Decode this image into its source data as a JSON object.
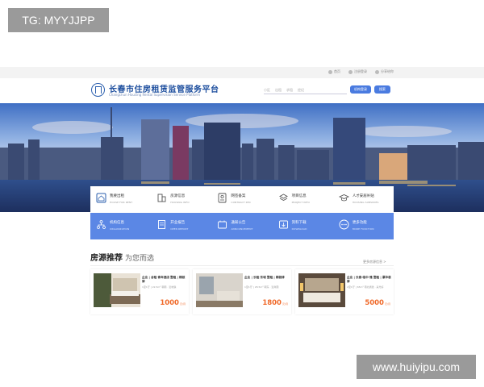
{
  "watermarks": {
    "top_left": "TG: MYYJJPP",
    "bottom_right": "www.huiyipu.com"
  },
  "topbar": {
    "links": [
      "首页",
      "注册登录",
      "分享给你"
    ]
  },
  "header": {
    "title": "长春市住房租赁监管服务平台",
    "subtitle": "Changchun Housing Rental Supervision Service Platform",
    "search_tabs": [
      "小区",
      "出租",
      "求租",
      "经纪"
    ],
    "btn_primary": "机构登录",
    "btn_secondary": "搜索"
  },
  "quick_top": [
    {
      "label": "我要出租",
      "en": "HOUSE FOR RENT",
      "icon": "house-icon"
    },
    {
      "label": "房源信息",
      "en": "HOUSING INFO",
      "icon": "building-icon"
    },
    {
      "label": "网签备案",
      "en": "CONTRACT REC",
      "icon": "id-card-icon"
    },
    {
      "label": "项目信息",
      "en": "PROJECT INFO",
      "icon": "layers-icon"
    },
    {
      "label": "人才安居补贴",
      "en": "HOUSING SUBSIDIES",
      "icon": "graduation-cap-icon"
    }
  ],
  "quick_bottom": [
    {
      "label": "机构信息",
      "en": "ORGANIZATION",
      "icon": "network-icon"
    },
    {
      "label": "开业报告",
      "en": "OPEN REPORT",
      "icon": "report-icon"
    },
    {
      "label": "通知公告",
      "en": "ANNOUNCEMENT",
      "icon": "notice-icon"
    },
    {
      "label": "资料下载",
      "en": "DOWNLOAD",
      "icon": "download-icon"
    },
    {
      "label": "更多功能",
      "en": "MORE FUNCTION",
      "icon": "more-icon"
    }
  ],
  "recommend": {
    "title": "房源推荐",
    "subtitle": "为您而选",
    "more": "更多房源信息 >",
    "cards": [
      {
        "name": "企业 | 合租·青年酒店 整租 | 精装修",
        "meta": "1室1厅 | 22.5m² 朝南 · 近地铁",
        "price": "1000",
        "unit": "元/月"
      },
      {
        "name": "企业 | 长租·东城 整租 | 精装修",
        "meta": "1室1厅 | 28.5m² 朝东 · 近商圈",
        "price": "1800",
        "unit": "元/月"
      },
      {
        "name": "企业 | 长春·临中·雅 整租 | 豪华装修",
        "meta": "2室1厅 | 65m² 南北通透 · 采光好",
        "price": "5000",
        "unit": "元/月"
      }
    ]
  },
  "colors": {
    "brand": "#1d4e9e",
    "accent": "#5b87e5",
    "price": "#f06a2a"
  }
}
